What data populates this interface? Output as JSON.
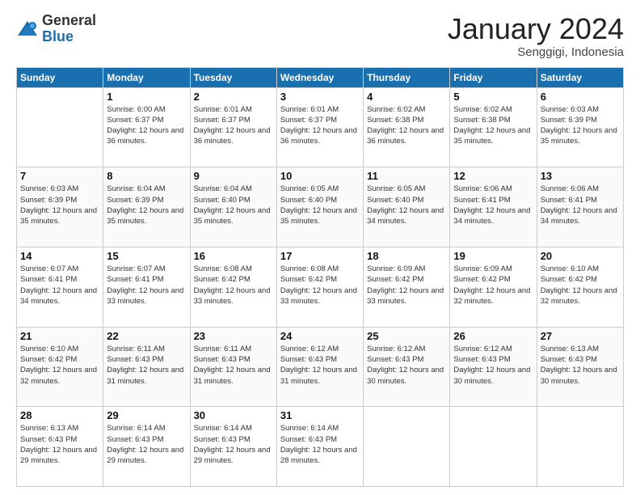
{
  "header": {
    "logo_general": "General",
    "logo_blue": "Blue",
    "month_title": "January 2024",
    "location": "Senggigi, Indonesia"
  },
  "days_of_week": [
    "Sunday",
    "Monday",
    "Tuesday",
    "Wednesday",
    "Thursday",
    "Friday",
    "Saturday"
  ],
  "weeks": [
    [
      {
        "day": "",
        "sunrise": "",
        "sunset": "",
        "daylight": ""
      },
      {
        "day": "1",
        "sunrise": "Sunrise: 6:00 AM",
        "sunset": "Sunset: 6:37 PM",
        "daylight": "Daylight: 12 hours and 36 minutes."
      },
      {
        "day": "2",
        "sunrise": "Sunrise: 6:01 AM",
        "sunset": "Sunset: 6:37 PM",
        "daylight": "Daylight: 12 hours and 36 minutes."
      },
      {
        "day": "3",
        "sunrise": "Sunrise: 6:01 AM",
        "sunset": "Sunset: 6:37 PM",
        "daylight": "Daylight: 12 hours and 36 minutes."
      },
      {
        "day": "4",
        "sunrise": "Sunrise: 6:02 AM",
        "sunset": "Sunset: 6:38 PM",
        "daylight": "Daylight: 12 hours and 36 minutes."
      },
      {
        "day": "5",
        "sunrise": "Sunrise: 6:02 AM",
        "sunset": "Sunset: 6:38 PM",
        "daylight": "Daylight: 12 hours and 35 minutes."
      },
      {
        "day": "6",
        "sunrise": "Sunrise: 6:03 AM",
        "sunset": "Sunset: 6:39 PM",
        "daylight": "Daylight: 12 hours and 35 minutes."
      }
    ],
    [
      {
        "day": "7",
        "sunrise": "Sunrise: 6:03 AM",
        "sunset": "Sunset: 6:39 PM",
        "daylight": "Daylight: 12 hours and 35 minutes."
      },
      {
        "day": "8",
        "sunrise": "Sunrise: 6:04 AM",
        "sunset": "Sunset: 6:39 PM",
        "daylight": "Daylight: 12 hours and 35 minutes."
      },
      {
        "day": "9",
        "sunrise": "Sunrise: 6:04 AM",
        "sunset": "Sunset: 6:40 PM",
        "daylight": "Daylight: 12 hours and 35 minutes."
      },
      {
        "day": "10",
        "sunrise": "Sunrise: 6:05 AM",
        "sunset": "Sunset: 6:40 PM",
        "daylight": "Daylight: 12 hours and 35 minutes."
      },
      {
        "day": "11",
        "sunrise": "Sunrise: 6:05 AM",
        "sunset": "Sunset: 6:40 PM",
        "daylight": "Daylight: 12 hours and 34 minutes."
      },
      {
        "day": "12",
        "sunrise": "Sunrise: 6:06 AM",
        "sunset": "Sunset: 6:41 PM",
        "daylight": "Daylight: 12 hours and 34 minutes."
      },
      {
        "day": "13",
        "sunrise": "Sunrise: 6:06 AM",
        "sunset": "Sunset: 6:41 PM",
        "daylight": "Daylight: 12 hours and 34 minutes."
      }
    ],
    [
      {
        "day": "14",
        "sunrise": "Sunrise: 6:07 AM",
        "sunset": "Sunset: 6:41 PM",
        "daylight": "Daylight: 12 hours and 34 minutes."
      },
      {
        "day": "15",
        "sunrise": "Sunrise: 6:07 AM",
        "sunset": "Sunset: 6:41 PM",
        "daylight": "Daylight: 12 hours and 33 minutes."
      },
      {
        "day": "16",
        "sunrise": "Sunrise: 6:08 AM",
        "sunset": "Sunset: 6:42 PM",
        "daylight": "Daylight: 12 hours and 33 minutes."
      },
      {
        "day": "17",
        "sunrise": "Sunrise: 6:08 AM",
        "sunset": "Sunset: 6:42 PM",
        "daylight": "Daylight: 12 hours and 33 minutes."
      },
      {
        "day": "18",
        "sunrise": "Sunrise: 6:09 AM",
        "sunset": "Sunset: 6:42 PM",
        "daylight": "Daylight: 12 hours and 33 minutes."
      },
      {
        "day": "19",
        "sunrise": "Sunrise: 6:09 AM",
        "sunset": "Sunset: 6:42 PM",
        "daylight": "Daylight: 12 hours and 32 minutes."
      },
      {
        "day": "20",
        "sunrise": "Sunrise: 6:10 AM",
        "sunset": "Sunset: 6:42 PM",
        "daylight": "Daylight: 12 hours and 32 minutes."
      }
    ],
    [
      {
        "day": "21",
        "sunrise": "Sunrise: 6:10 AM",
        "sunset": "Sunset: 6:42 PM",
        "daylight": "Daylight: 12 hours and 32 minutes."
      },
      {
        "day": "22",
        "sunrise": "Sunrise: 6:11 AM",
        "sunset": "Sunset: 6:43 PM",
        "daylight": "Daylight: 12 hours and 31 minutes."
      },
      {
        "day": "23",
        "sunrise": "Sunrise: 6:11 AM",
        "sunset": "Sunset: 6:43 PM",
        "daylight": "Daylight: 12 hours and 31 minutes."
      },
      {
        "day": "24",
        "sunrise": "Sunrise: 6:12 AM",
        "sunset": "Sunset: 6:43 PM",
        "daylight": "Daylight: 12 hours and 31 minutes."
      },
      {
        "day": "25",
        "sunrise": "Sunrise: 6:12 AM",
        "sunset": "Sunset: 6:43 PM",
        "daylight": "Daylight: 12 hours and 30 minutes."
      },
      {
        "day": "26",
        "sunrise": "Sunrise: 6:12 AM",
        "sunset": "Sunset: 6:43 PM",
        "daylight": "Daylight: 12 hours and 30 minutes."
      },
      {
        "day": "27",
        "sunrise": "Sunrise: 6:13 AM",
        "sunset": "Sunset: 6:43 PM",
        "daylight": "Daylight: 12 hours and 30 minutes."
      }
    ],
    [
      {
        "day": "28",
        "sunrise": "Sunrise: 6:13 AM",
        "sunset": "Sunset: 6:43 PM",
        "daylight": "Daylight: 12 hours and 29 minutes."
      },
      {
        "day": "29",
        "sunrise": "Sunrise: 6:14 AM",
        "sunset": "Sunset: 6:43 PM",
        "daylight": "Daylight: 12 hours and 29 minutes."
      },
      {
        "day": "30",
        "sunrise": "Sunrise: 6:14 AM",
        "sunset": "Sunset: 6:43 PM",
        "daylight": "Daylight: 12 hours and 29 minutes."
      },
      {
        "day": "31",
        "sunrise": "Sunrise: 6:14 AM",
        "sunset": "Sunset: 6:43 PM",
        "daylight": "Daylight: 12 hours and 28 minutes."
      },
      {
        "day": "",
        "sunrise": "",
        "sunset": "",
        "daylight": ""
      },
      {
        "day": "",
        "sunrise": "",
        "sunset": "",
        "daylight": ""
      },
      {
        "day": "",
        "sunrise": "",
        "sunset": "",
        "daylight": ""
      }
    ]
  ]
}
